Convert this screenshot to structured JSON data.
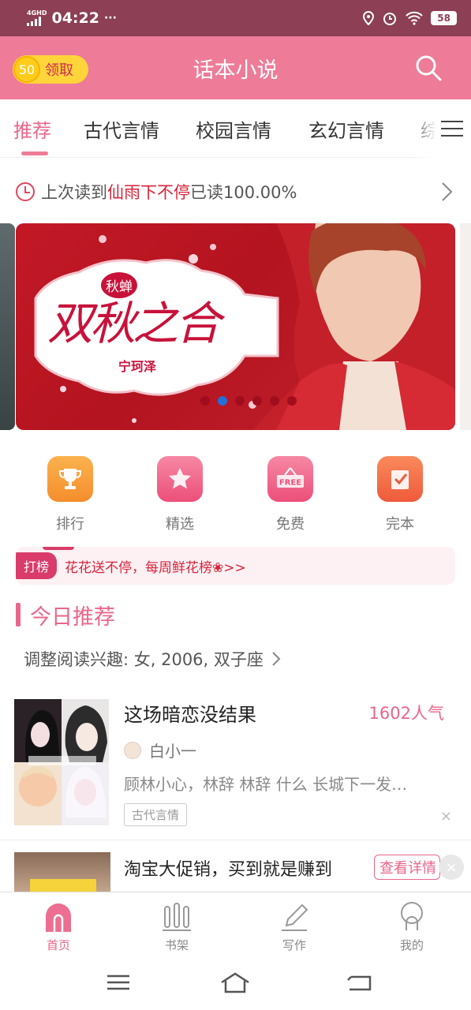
{
  "status_bar": {
    "network": "4GHD",
    "time": "04:22",
    "more": "···",
    "battery": "58"
  },
  "header": {
    "coin_amount": "50",
    "coin_label": "领取",
    "title": "话本小说",
    "search_icon": "search-icon"
  },
  "tabs": [
    "推荐",
    "古代言情",
    "校园言情",
    "玄幻言情",
    "综"
  ],
  "last_read": {
    "prefix": "上次读到",
    "book": "仙雨下不停",
    "suffix": "已读100.00%"
  },
  "banner": {
    "tag": "秋蝉",
    "title": "双秋之合",
    "author": "宁珂泽",
    "dot_count": 6,
    "active_dot": 1
  },
  "quick_nav": [
    {
      "label": "排行",
      "icon": "trophy-icon",
      "color": "#f7a03d"
    },
    {
      "label": "精选",
      "icon": "star-icon",
      "color": "#f2698e"
    },
    {
      "label": "免费",
      "icon": "free-icon",
      "color": "#f2698e"
    },
    {
      "label": "完本",
      "icon": "check-icon",
      "color": "#f36f4a"
    }
  ],
  "promo": {
    "tag": "打榜",
    "text": "花花送不停，每周鲜花榜❀>>"
  },
  "section": {
    "title": "今日推荐",
    "preference": "调整阅读兴趣: 女, 2006, 双子座"
  },
  "book": {
    "title": "这场暗恋没结果",
    "popularity": "1602人气",
    "author": "白小一",
    "desc": "顾林小心，林辞 林辞 什么 长城下一发…",
    "tag": "古代言情",
    "close": "×"
  },
  "ad": {
    "text": "淘宝大促销，买到就是赚到",
    "button": "查看详情",
    "close": "×"
  },
  "bottom_nav": [
    {
      "label": "首页",
      "icon": "home-icon",
      "active": true
    },
    {
      "label": "书架",
      "icon": "bookshelf-icon",
      "active": false
    },
    {
      "label": "写作",
      "icon": "pen-icon",
      "active": false
    },
    {
      "label": "我的",
      "icon": "profile-icon",
      "active": false
    }
  ],
  "colors": {
    "brand": "#ee7b97",
    "accent": "#e9668a",
    "status_bar": "#8c3f55",
    "link_red": "#d8243a"
  }
}
